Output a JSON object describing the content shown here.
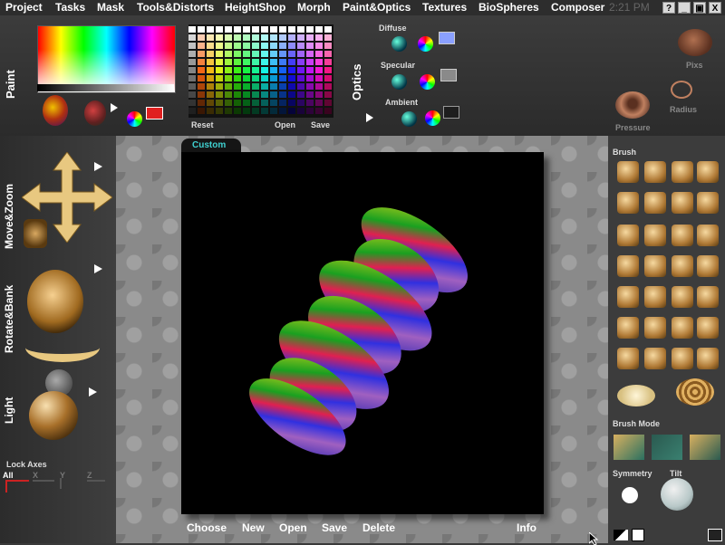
{
  "menu": {
    "items": [
      "Project",
      "Tasks",
      "Mask",
      "Tools&Distorts",
      "HeightShop",
      "Morph",
      "Paint&Optics",
      "Textures",
      "BioSpheres",
      "Composer"
    ],
    "clock": "2:21 PM",
    "help": "?",
    "minimize": "_",
    "maximize": "▣",
    "close": "X"
  },
  "paint": {
    "label": "Paint",
    "palette_buttons": {
      "reset": "Reset",
      "open": "Open",
      "save": "Save"
    },
    "current_color": "#e02020"
  },
  "optics": {
    "label": "Optics",
    "diffuse": {
      "label": "Diffuse",
      "color": "#8aa0ff"
    },
    "specular": {
      "label": "Specular",
      "color": "#8a8a8a"
    },
    "ambient": {
      "label": "Ambient",
      "color": "#1e1e1e"
    }
  },
  "pressure_tools": {
    "pixs": "Pixs",
    "pressure": "Pressure",
    "radius": "Radius"
  },
  "left": {
    "move_zoom": "Move&Zoom",
    "rotate_bank": "Rotate&Bank",
    "light": "Light",
    "lock_axes": {
      "label": "Lock Axes",
      "all": "All",
      "x": "X",
      "y": "Y",
      "z": "Z"
    }
  },
  "canvas": {
    "tab": "Custom",
    "actions": {
      "choose": "Choose",
      "new": "New",
      "open": "Open",
      "save": "Save",
      "delete": "Delete",
      "info": "Info"
    }
  },
  "right": {
    "brush": "Brush",
    "brush_mode": "Brush Mode",
    "symmetry": "Symmetry",
    "tilt": "Tilt"
  }
}
